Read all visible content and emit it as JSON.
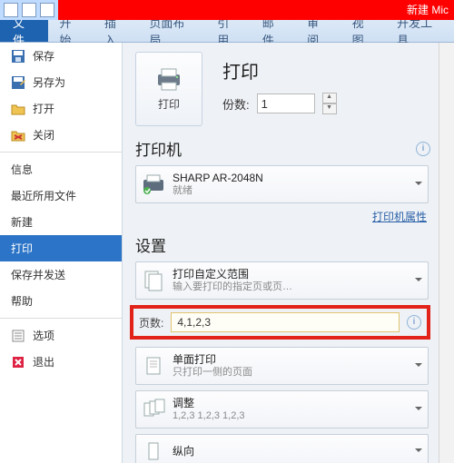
{
  "window": {
    "title_fragment": "新建 Mic"
  },
  "ribbon": {
    "file": "文件",
    "tabs": [
      "开始",
      "插入",
      "页面布局",
      "引用",
      "邮件",
      "审阅",
      "视图",
      "开发工具"
    ]
  },
  "sidebar": {
    "items": [
      {
        "label": "保存"
      },
      {
        "label": "另存为"
      },
      {
        "label": "打开"
      },
      {
        "label": "关闭"
      },
      {
        "label": "信息"
      },
      {
        "label": "最近所用文件"
      },
      {
        "label": "新建"
      },
      {
        "label": "打印"
      },
      {
        "label": "保存并发送"
      },
      {
        "label": "帮助"
      },
      {
        "label": "选项"
      },
      {
        "label": "退出"
      }
    ]
  },
  "print": {
    "big_button": "打印",
    "heading": "打印",
    "copies_label": "份数:",
    "copies_value": "1",
    "printer_section": "打印机",
    "printer_name": "SHARP AR-2048N",
    "printer_status": "就绪",
    "printer_props": "打印机属性",
    "settings_section": "设置",
    "range_main": "打印自定义范围",
    "range_sub": "输入要打印的指定页或页…",
    "pages_label": "页数:",
    "pages_value": "4,1,2,3",
    "duplex_main": "单面打印",
    "duplex_sub": "只打印一侧的页面",
    "collate_main": "调整",
    "collate_sub": "1,2,3    1,2,3    1,2,3",
    "orient_main": "纵向"
  }
}
